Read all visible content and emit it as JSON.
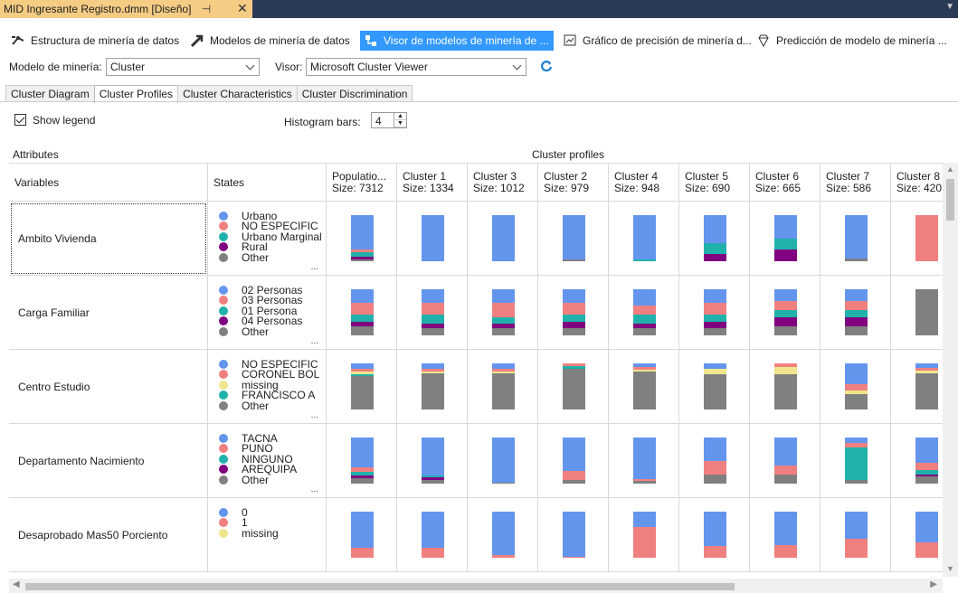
{
  "document_tab": {
    "title": "MID Ingresante Registro.dmm [Diseño]",
    "pin": "⊣",
    "close": "✕"
  },
  "toolbar": {
    "items": [
      {
        "label": "Estructura de minería de datos",
        "icon": "mining-structure-icon"
      },
      {
        "label": "Modelos de minería de datos",
        "icon": "mining-models-icon"
      },
      {
        "label": "Visor de modelos de minería de ...",
        "icon": "model-viewer-icon",
        "active": true
      },
      {
        "label": "Gráfico de precisión de minería d...",
        "icon": "accuracy-chart-icon"
      },
      {
        "label": "Predicción de modelo de minería ...",
        "icon": "prediction-icon"
      }
    ]
  },
  "model_row": {
    "model_label": "Modelo de minería:",
    "model_value": "Cluster",
    "viewer_label": "Visor:",
    "viewer_value": "Microsoft Cluster Viewer"
  },
  "view_tabs": [
    "Cluster Diagram",
    "Cluster Profiles",
    "Cluster Characteristics",
    "Cluster Discrimination"
  ],
  "active_view_tab": 1,
  "options": {
    "show_legend_label": "Show legend",
    "show_legend_checked": true,
    "histogram_label": "Histogram bars:",
    "histogram_value": "4"
  },
  "section_headers": {
    "attributes": "Attributes",
    "cluster_profiles": "Cluster profiles"
  },
  "grid": {
    "variables_header": "Variables",
    "states_header": "States",
    "state_colors": [
      "#6495ed",
      "#f08080",
      "#20b2aa",
      "#800080",
      "#808080",
      "#f0e68c"
    ],
    "clusters": [
      {
        "name": "Populatio...",
        "size": "Size: 7312"
      },
      {
        "name": "Cluster 1",
        "size": "Size: 1334"
      },
      {
        "name": "Cluster 3",
        "size": "Size: 1012"
      },
      {
        "name": "Cluster 2",
        "size": "Size: 979"
      },
      {
        "name": "Cluster 4",
        "size": "Size: 948"
      },
      {
        "name": "Cluster 5",
        "size": "Size: 690"
      },
      {
        "name": "Cluster 6",
        "size": "Size: 665"
      },
      {
        "name": "Cluster 7",
        "size": "Size: 586"
      },
      {
        "name": "Cluster 8",
        "size": "Size: 420"
      }
    ],
    "rows": [
      {
        "variable": "Ambito Vivienda",
        "states": [
          {
            "label": "Urbano",
            "color": "#6495ed"
          },
          {
            "label": "NO ESPECIFIC",
            "color": "#f08080"
          },
          {
            "label": "Urbano Marginal",
            "color": "#20b2aa"
          },
          {
            "label": "Rural",
            "color": "#800080"
          },
          {
            "label": "Other",
            "color": "#808080"
          }
        ],
        "profiles": [
          [
            {
              "c": "#6495ed",
              "v": 0.74
            },
            {
              "c": "#f08080",
              "v": 0.06
            },
            {
              "c": "#20b2aa",
              "v": 0.1
            },
            {
              "c": "#800080",
              "v": 0.06
            },
            {
              "c": "#808080",
              "v": 0.04
            }
          ],
          [
            {
              "c": "#6495ed",
              "v": 1.0
            }
          ],
          [
            {
              "c": "#6495ed",
              "v": 1.0
            }
          ],
          [
            {
              "c": "#6495ed",
              "v": 0.96
            },
            {
              "c": "#808080",
              "v": 0.04
            }
          ],
          [
            {
              "c": "#6495ed",
              "v": 0.97
            },
            {
              "c": "#20b2aa",
              "v": 0.03
            }
          ],
          [
            {
              "c": "#6495ed",
              "v": 0.6
            },
            {
              "c": "#20b2aa",
              "v": 0.25
            },
            {
              "c": "#800080",
              "v": 0.15
            }
          ],
          [
            {
              "c": "#6495ed",
              "v": 0.5
            },
            {
              "c": "#20b2aa",
              "v": 0.25
            },
            {
              "c": "#800080",
              "v": 0.25
            }
          ],
          [
            {
              "c": "#6495ed",
              "v": 0.94
            },
            {
              "c": "#808080",
              "v": 0.06
            }
          ],
          [
            {
              "c": "#f08080",
              "v": 1.0
            }
          ]
        ]
      },
      {
        "variable": "Carga Familiar",
        "states": [
          {
            "label": "02 Personas",
            "color": "#6495ed"
          },
          {
            "label": "03 Personas",
            "color": "#f08080"
          },
          {
            "label": "01 Persona",
            "color": "#20b2aa"
          },
          {
            "label": "04 Personas",
            "color": "#800080"
          },
          {
            "label": "Other",
            "color": "#808080"
          }
        ],
        "profiles": [
          [
            {
              "c": "#6495ed",
              "v": 0.3
            },
            {
              "c": "#f08080",
              "v": 0.25
            },
            {
              "c": "#20b2aa",
              "v": 0.15
            },
            {
              "c": "#800080",
              "v": 0.1
            },
            {
              "c": "#808080",
              "v": 0.2
            }
          ],
          [
            {
              "c": "#6495ed",
              "v": 0.3
            },
            {
              "c": "#f08080",
              "v": 0.25
            },
            {
              "c": "#20b2aa",
              "v": 0.2
            },
            {
              "c": "#800080",
              "v": 0.1
            },
            {
              "c": "#808080",
              "v": 0.15
            }
          ],
          [
            {
              "c": "#6495ed",
              "v": 0.3
            },
            {
              "c": "#f08080",
              "v": 0.3
            },
            {
              "c": "#20b2aa",
              "v": 0.15
            },
            {
              "c": "#800080",
              "v": 0.1
            },
            {
              "c": "#808080",
              "v": 0.15
            }
          ],
          [
            {
              "c": "#6495ed",
              "v": 0.3
            },
            {
              "c": "#f08080",
              "v": 0.25
            },
            {
              "c": "#20b2aa",
              "v": 0.15
            },
            {
              "c": "#800080",
              "v": 0.15
            },
            {
              "c": "#808080",
              "v": 0.15
            }
          ],
          [
            {
              "c": "#6495ed",
              "v": 0.35
            },
            {
              "c": "#f08080",
              "v": 0.2
            },
            {
              "c": "#20b2aa",
              "v": 0.2
            },
            {
              "c": "#800080",
              "v": 0.1
            },
            {
              "c": "#808080",
              "v": 0.15
            }
          ],
          [
            {
              "c": "#6495ed",
              "v": 0.3
            },
            {
              "c": "#f08080",
              "v": 0.25
            },
            {
              "c": "#20b2aa",
              "v": 0.15
            },
            {
              "c": "#800080",
              "v": 0.15
            },
            {
              "c": "#808080",
              "v": 0.15
            }
          ],
          [
            {
              "c": "#6495ed",
              "v": 0.25
            },
            {
              "c": "#f08080",
              "v": 0.2
            },
            {
              "c": "#20b2aa",
              "v": 0.15
            },
            {
              "c": "#800080",
              "v": 0.2
            },
            {
              "c": "#808080",
              "v": 0.2
            }
          ],
          [
            {
              "c": "#6495ed",
              "v": 0.25
            },
            {
              "c": "#f08080",
              "v": 0.2
            },
            {
              "c": "#20b2aa",
              "v": 0.15
            },
            {
              "c": "#800080",
              "v": 0.2
            },
            {
              "c": "#808080",
              "v": 0.2
            }
          ],
          [
            {
              "c": "#808080",
              "v": 1.0
            }
          ]
        ]
      },
      {
        "variable": "Centro Estudio",
        "states": [
          {
            "label": "NO ESPECIFIC",
            "color": "#6495ed"
          },
          {
            "label": "CORONEL BOL",
            "color": "#f08080"
          },
          {
            "label": "missing",
            "color": "#f0e68c"
          },
          {
            "label": "FRANCISCO A",
            "color": "#20b2aa"
          },
          {
            "label": "Other",
            "color": "#808080"
          }
        ],
        "profiles": [
          [
            {
              "c": "#6495ed",
              "v": 0.12
            },
            {
              "c": "#f08080",
              "v": 0.06
            },
            {
              "c": "#f0e68c",
              "v": 0.05
            },
            {
              "c": "#20b2aa",
              "v": 0.04
            },
            {
              "c": "#808080",
              "v": 0.73
            }
          ],
          [
            {
              "c": "#6495ed",
              "v": 0.12
            },
            {
              "c": "#f08080",
              "v": 0.06
            },
            {
              "c": "#f0e68c",
              "v": 0.04
            },
            {
              "c": "#808080",
              "v": 0.78
            }
          ],
          [
            {
              "c": "#6495ed",
              "v": 0.12
            },
            {
              "c": "#f08080",
              "v": 0.06
            },
            {
              "c": "#f0e68c",
              "v": 0.04
            },
            {
              "c": "#808080",
              "v": 0.78
            }
          ],
          [
            {
              "c": "#f08080",
              "v": 0.06
            },
            {
              "c": "#20b2aa",
              "v": 0.06
            },
            {
              "c": "#808080",
              "v": 0.88
            }
          ],
          [
            {
              "c": "#6495ed",
              "v": 0.08
            },
            {
              "c": "#f08080",
              "v": 0.06
            },
            {
              "c": "#f0e68c",
              "v": 0.04
            },
            {
              "c": "#808080",
              "v": 0.82
            }
          ],
          [
            {
              "c": "#6495ed",
              "v": 0.12
            },
            {
              "c": "#f0e68c",
              "v": 0.12
            },
            {
              "c": "#808080",
              "v": 0.76
            }
          ],
          [
            {
              "c": "#f08080",
              "v": 0.08
            },
            {
              "c": "#f0e68c",
              "v": 0.15
            },
            {
              "c": "#808080",
              "v": 0.77
            }
          ],
          [
            {
              "c": "#6495ed",
              "v": 0.45
            },
            {
              "c": "#f08080",
              "v": 0.14
            },
            {
              "c": "#f0e68c",
              "v": 0.08
            },
            {
              "c": "#808080",
              "v": 0.33
            }
          ],
          [
            {
              "c": "#6495ed",
              "v": 0.1
            },
            {
              "c": "#f08080",
              "v": 0.06
            },
            {
              "c": "#f0e68c",
              "v": 0.06
            },
            {
              "c": "#808080",
              "v": 0.78
            }
          ]
        ]
      },
      {
        "variable": "Departamento Nacimiento",
        "states": [
          {
            "label": "TACNA",
            "color": "#6495ed"
          },
          {
            "label": "PUNO",
            "color": "#f08080"
          },
          {
            "label": "NINGUNO",
            "color": "#20b2aa"
          },
          {
            "label": "AREQUIPA",
            "color": "#800080"
          },
          {
            "label": "Other",
            "color": "#808080"
          }
        ],
        "profiles": [
          [
            {
              "c": "#6495ed",
              "v": 0.65
            },
            {
              "c": "#f08080",
              "v": 0.1
            },
            {
              "c": "#20b2aa",
              "v": 0.08
            },
            {
              "c": "#800080",
              "v": 0.05
            },
            {
              "c": "#808080",
              "v": 0.12
            }
          ],
          [
            {
              "c": "#6495ed",
              "v": 0.82
            },
            {
              "c": "#20b2aa",
              "v": 0.05
            },
            {
              "c": "#800080",
              "v": 0.05
            },
            {
              "c": "#808080",
              "v": 0.08
            }
          ],
          [
            {
              "c": "#6495ed",
              "v": 0.98
            },
            {
              "c": "#808080",
              "v": 0.02
            }
          ],
          [
            {
              "c": "#6495ed",
              "v": 0.72
            },
            {
              "c": "#f08080",
              "v": 0.2
            },
            {
              "c": "#808080",
              "v": 0.08
            }
          ],
          [
            {
              "c": "#6495ed",
              "v": 0.9
            },
            {
              "c": "#f08080",
              "v": 0.04
            },
            {
              "c": "#808080",
              "v": 0.06
            }
          ],
          [
            {
              "c": "#6495ed",
              "v": 0.5
            },
            {
              "c": "#f08080",
              "v": 0.3
            },
            {
              "c": "#808080",
              "v": 0.2
            }
          ],
          [
            {
              "c": "#6495ed",
              "v": 0.6
            },
            {
              "c": "#f08080",
              "v": 0.2
            },
            {
              "c": "#808080",
              "v": 0.2
            }
          ],
          [
            {
              "c": "#6495ed",
              "v": 0.12
            },
            {
              "c": "#f08080",
              "v": 0.1
            },
            {
              "c": "#20b2aa",
              "v": 0.7
            },
            {
              "c": "#808080",
              "v": 0.08
            }
          ],
          [
            {
              "c": "#6495ed",
              "v": 0.55
            },
            {
              "c": "#f08080",
              "v": 0.15
            },
            {
              "c": "#20b2aa",
              "v": 0.1
            },
            {
              "c": "#800080",
              "v": 0.05
            },
            {
              "c": "#808080",
              "v": 0.15
            }
          ]
        ]
      },
      {
        "variable": "Desaprobado Mas50 Porciento",
        "states": [
          {
            "label": "0",
            "color": "#6495ed"
          },
          {
            "label": "1",
            "color": "#f08080"
          },
          {
            "label": "missing",
            "color": "#f0e68c"
          }
        ],
        "profiles": [
          [
            {
              "c": "#6495ed",
              "v": 0.78
            },
            {
              "c": "#f08080",
              "v": 0.22
            }
          ],
          [
            {
              "c": "#6495ed",
              "v": 0.78
            },
            {
              "c": "#f08080",
              "v": 0.22
            }
          ],
          [
            {
              "c": "#6495ed",
              "v": 0.95
            },
            {
              "c": "#f08080",
              "v": 0.05
            }
          ],
          [
            {
              "c": "#6495ed",
              "v": 0.98
            },
            {
              "c": "#f08080",
              "v": 0.02
            }
          ],
          [
            {
              "c": "#6495ed",
              "v": 0.33
            },
            {
              "c": "#f08080",
              "v": 0.67
            }
          ],
          [
            {
              "c": "#6495ed",
              "v": 0.75
            },
            {
              "c": "#f08080",
              "v": 0.25
            }
          ],
          [
            {
              "c": "#6495ed",
              "v": 0.72
            },
            {
              "c": "#f08080",
              "v": 0.28
            }
          ],
          [
            {
              "c": "#6495ed",
              "v": 0.58
            },
            {
              "c": "#f08080",
              "v": 0.42
            }
          ],
          [
            {
              "c": "#6495ed",
              "v": 0.66
            },
            {
              "c": "#f08080",
              "v": 0.34
            }
          ]
        ]
      }
    ]
  }
}
